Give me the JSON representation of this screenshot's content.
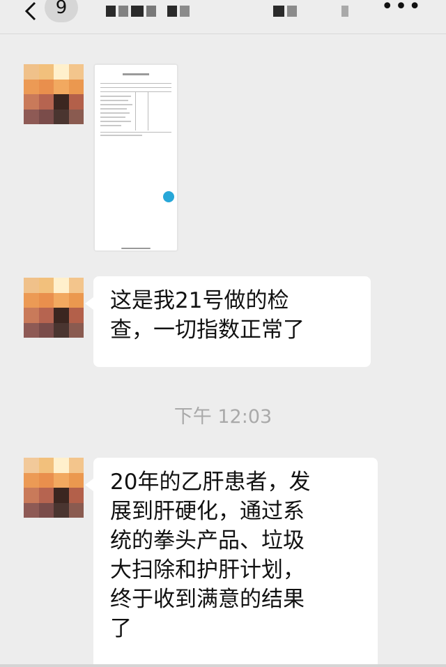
{
  "header": {
    "unread_count": "9"
  },
  "messages": [
    {
      "type": "image"
    },
    {
      "type": "text",
      "lines": [
        "这是我21号做的检",
        "查，一切指数正常了"
      ]
    },
    {
      "type": "timestamp",
      "text": "下午 12:03"
    },
    {
      "type": "text",
      "lines": [
        "20年的乙肝患者，发",
        "展到肝硬化，通过系",
        "统的拳头产品、垃圾",
        "大扫除和护肝计划，",
        "终于收到满意的结果",
        "了"
      ]
    }
  ],
  "colors": {
    "background": "#ededed",
    "bubble": "#ffffff",
    "timestamp": "#a9a9a9"
  }
}
